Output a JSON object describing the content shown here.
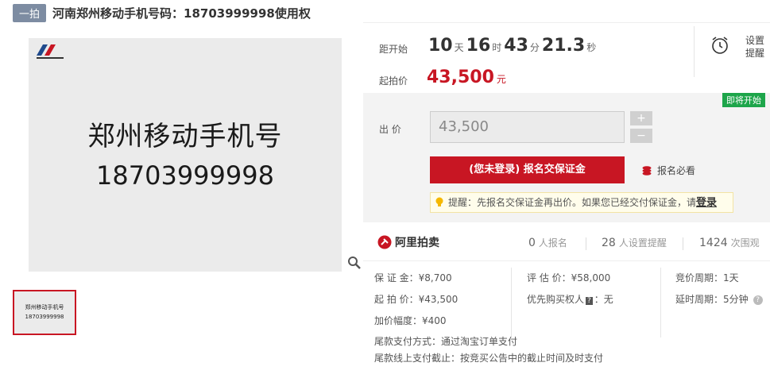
{
  "header": {
    "tag": "一拍",
    "title": "河南郑州移动手机号码：18703999998使用权"
  },
  "gallery": {
    "main_line1": "郑州移动手机号",
    "main_line2": "18703999998",
    "thumb_line1": "郑州移动手机号",
    "thumb_line2": "18703999998"
  },
  "auction": {
    "countdown_label": "距开始",
    "days": "10",
    "days_unit": "天",
    "hours": "16",
    "hours_unit": "时",
    "minutes": "43",
    "minutes_unit": "分",
    "seconds": "21.3",
    "seconds_unit": "秒",
    "start_price_label": "起拍价",
    "start_price": "43,500",
    "currency_unit": "元",
    "remind_label_1": "设置",
    "remind_label_2": "提醒"
  },
  "bid": {
    "badge": "即将开始",
    "label": "出  价",
    "value": "43,500",
    "plus": "+",
    "minus": "−",
    "register_button": "(您未登录) 报名交保证金",
    "must_read": "报名必看",
    "tip_text": "提醒：先报名交保证金再出价。如果您已经交付保证金，请",
    "tip_login": "登录"
  },
  "stats": {
    "brand": "阿里拍卖",
    "registrations": "0",
    "registrations_label": "人报名",
    "reminders": "28",
    "reminders_label": "人设置提醒",
    "views": "1424",
    "views_label": "次围观"
  },
  "details": {
    "deposit": "保 证 金：¥8,700",
    "estimate": "评 估 价：¥58,000",
    "cycle": "竞价周期：1天",
    "start_price": "起 拍 价：¥43,500",
    "priority_a": "优先购买权人",
    "priority_badge": "?",
    "priority_b": "：无",
    "delay": "延时周期：5分钟",
    "increment": "加价幅度：¥400",
    "payment_method": "尾款支付方式：通过淘宝订单支付",
    "payment_deadline": "尾款线上支付截止：按竞买公告中的截止时间及时支付"
  },
  "colors": {
    "accent": "#c81623",
    "badge_green": "#1da54a",
    "tag": "#7d8ca2"
  }
}
